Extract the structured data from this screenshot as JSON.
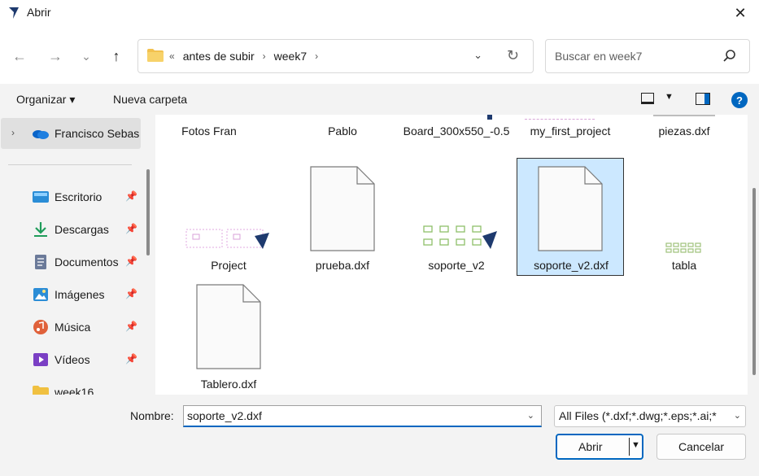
{
  "window": {
    "title": "Abrir",
    "close_glyph": "✕"
  },
  "nav": {
    "back": "←",
    "forward": "→",
    "recent": "⌄",
    "up": "↑"
  },
  "address": {
    "overflow": "«",
    "crumbs": [
      "antes de subir",
      "week7"
    ],
    "sep": "›",
    "dropdown": "⌄",
    "refresh": "↻"
  },
  "search": {
    "placeholder": "Buscar en week7"
  },
  "toolbar": {
    "organizar": "Organizar ▾",
    "nueva_carpeta": "Nueva carpeta",
    "help": "?"
  },
  "sidebar": {
    "onedrive_label": "Francisco Sebas",
    "items": [
      {
        "label": "Escritorio",
        "icon": "desktop-icon",
        "color": "#2b8dd6"
      },
      {
        "label": "Descargas",
        "icon": "download-icon",
        "color": "#1f9c5a"
      },
      {
        "label": "Documentos",
        "icon": "documents-icon",
        "color": "#6b7a99"
      },
      {
        "label": "Imágenes",
        "icon": "pictures-icon",
        "color": "#2b8dd6"
      },
      {
        "label": "Música",
        "icon": "music-icon",
        "color": "#e0613a"
      },
      {
        "label": "Vídeos",
        "icon": "videos-icon",
        "color": "#7a3fc4"
      },
      {
        "label": "week16",
        "icon": "folder-icon",
        "color": "#f0c040"
      }
    ],
    "pin": "📌"
  },
  "files": {
    "row1": [
      "Fotos Fran",
      "Pablo",
      "Board_300x550_-0.5",
      "my_first_project",
      "piezas.dxf"
    ],
    "row2": [
      "Project",
      "prueba.dxf",
      "soporte_v2",
      "soporte_v2.dxf",
      "tabla"
    ],
    "row3": [
      "Tablero.dxf"
    ],
    "selected": "soporte_v2.dxf"
  },
  "footer": {
    "nombre_label": "Nombre:",
    "filename": "soporte_v2.dxf",
    "filter": "All Files (*.dxf;*.dwg;*.eps;*.ai;*",
    "open": "Abrir",
    "cancel": "Cancelar",
    "dropdown": "⌄"
  },
  "colors": {
    "accent": "#0067c0",
    "selection": "#cce8ff"
  }
}
